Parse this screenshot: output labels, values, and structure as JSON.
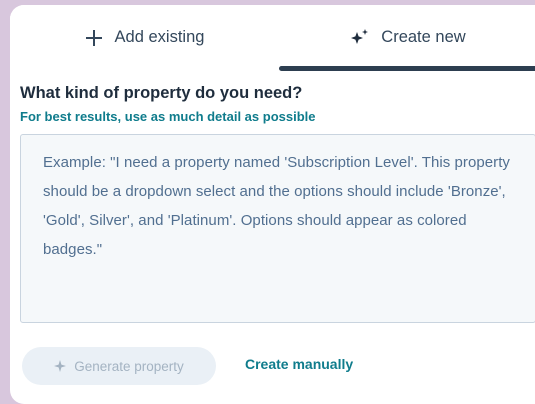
{
  "tabs": {
    "add_existing_label": "Add existing",
    "create_new_label": "Create new",
    "active": "Create new"
  },
  "form": {
    "heading": "What kind of property do you need?",
    "subheading": "For best results, use as much detail as possible",
    "placeholder": "Example: \"I need a property named 'Subscription Level'. This property should be a dropdown select and the options should include 'Bronze', 'Gold', Silver', and 'Platinum'. Options should appear as colored badges.\""
  },
  "actions": {
    "generate_label": "Generate property",
    "generate_disabled": true,
    "manual_label": "Create manually"
  },
  "icons": {
    "add": "plus-icon",
    "create": "sparkle-icon",
    "generate": "sparkle-icon"
  },
  "colors": {
    "background": "#d8c7dd",
    "accent_teal": "#0f7c8c",
    "tab_underline": "#2d3e50",
    "text_primary": "#1f2d3d",
    "text_muted": "#516f90"
  }
}
